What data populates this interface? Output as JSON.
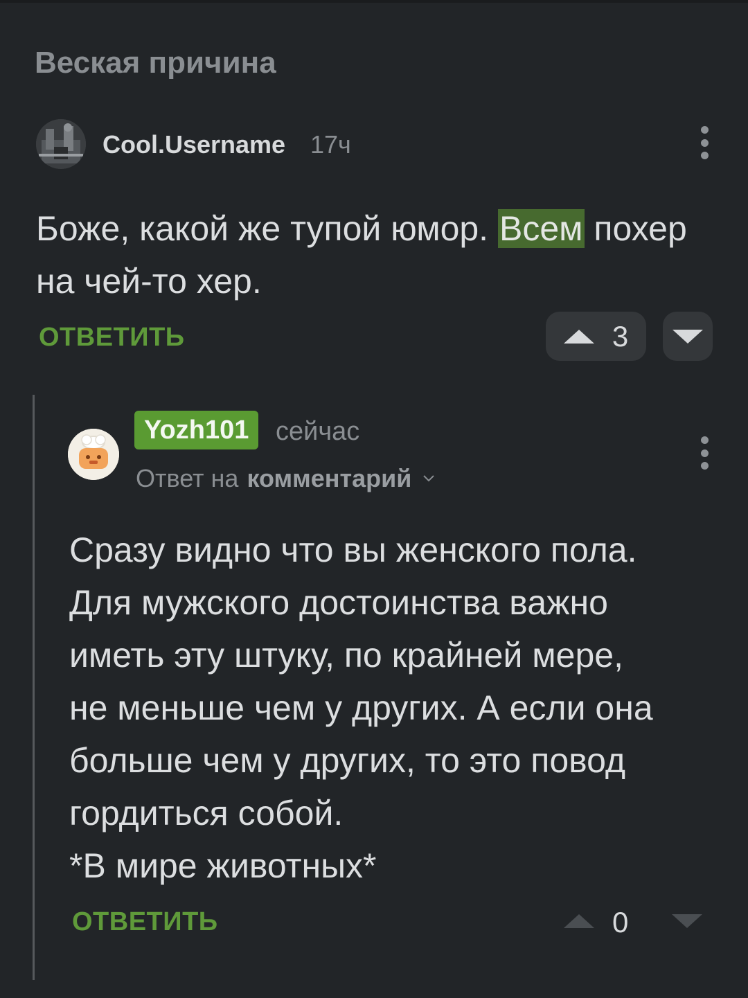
{
  "post": {
    "title": "Веская причина"
  },
  "comment1": {
    "username": "Cool.Username",
    "time": "17ч",
    "text_before": "Боже, какой же тупой юмор. ",
    "text_highlight": "Всем",
    "text_after": " похер на чей-то хер.",
    "reply_label": "ОТВЕТИТЬ",
    "score": "3"
  },
  "comment2": {
    "username": "Yozh101",
    "time": "сейчас",
    "reply_to_prefix": "Ответ на",
    "reply_to_target": "комментарий",
    "lines": [
      "Сразу видно что вы женского пола.",
      "Для мужского достоинства важно",
      "иметь эту штуку, по крайней мере,",
      "не меньше чем у других. А если она",
      "больше чем у других, то это повод",
      "гордиться собой.",
      "*В мире животных*"
    ],
    "reply_label": "ОТВЕТИТЬ",
    "score": "0"
  },
  "colors": {
    "background": "#222528",
    "accent_green": "#5f9a3a",
    "badge_green": "#5a9b32",
    "highlight": "#476a2f"
  }
}
